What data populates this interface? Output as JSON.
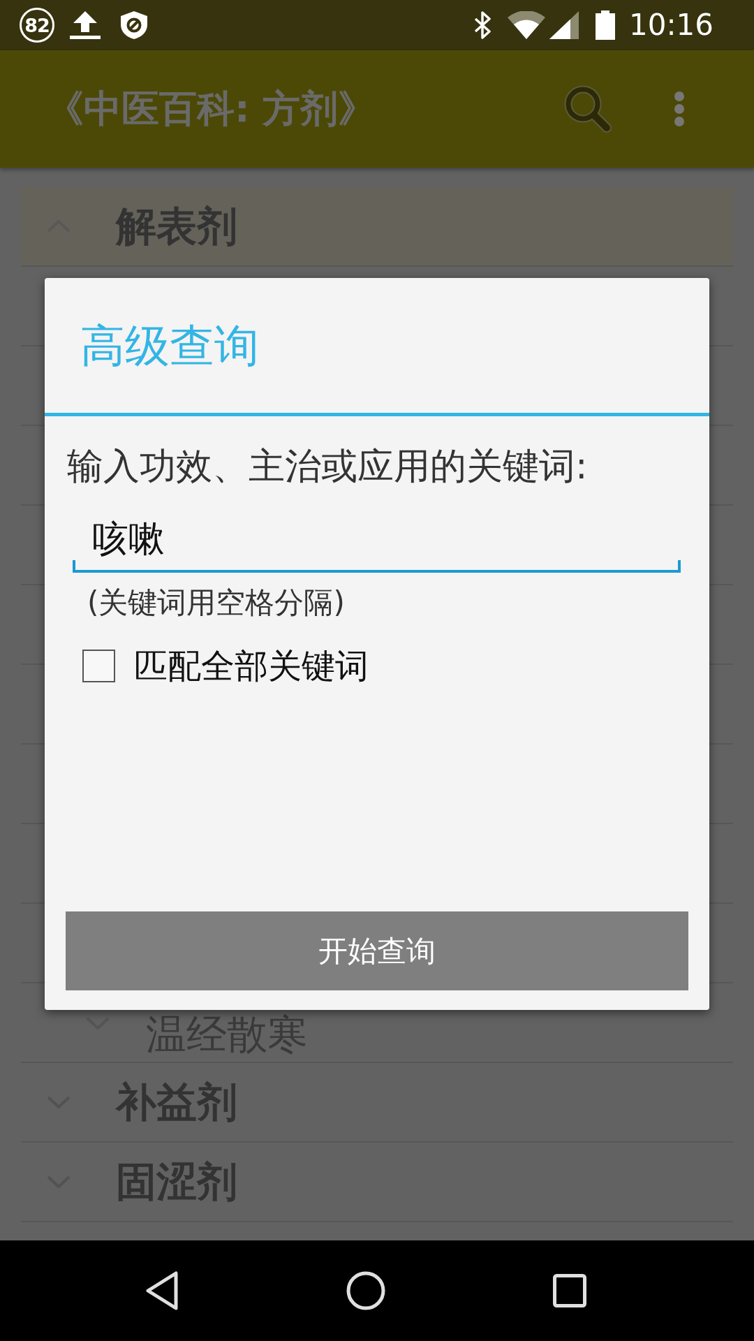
{
  "status_bar": {
    "notification_count": "82",
    "time": "10:16"
  },
  "app_bar": {
    "title": "《中医百科: 方剂》"
  },
  "list": {
    "groups": [
      {
        "label": "解表剂",
        "expanded": true
      },
      {
        "children": [
          {
            "label": "温经散寒",
            "expanded": false
          }
        ]
      },
      {
        "label": "补益剂",
        "expanded": false
      },
      {
        "label": "固涩剂",
        "expanded": false
      }
    ]
  },
  "dialog": {
    "title": "高级查询",
    "prompt": "输入功效、主治或应用的关键词:",
    "keyword_field": {
      "value": "咳嗽"
    },
    "hint": "(关键词用空格分隔)",
    "match_all": {
      "label": "匹配全部关键词",
      "checked": false
    },
    "button": "开始查询"
  }
}
